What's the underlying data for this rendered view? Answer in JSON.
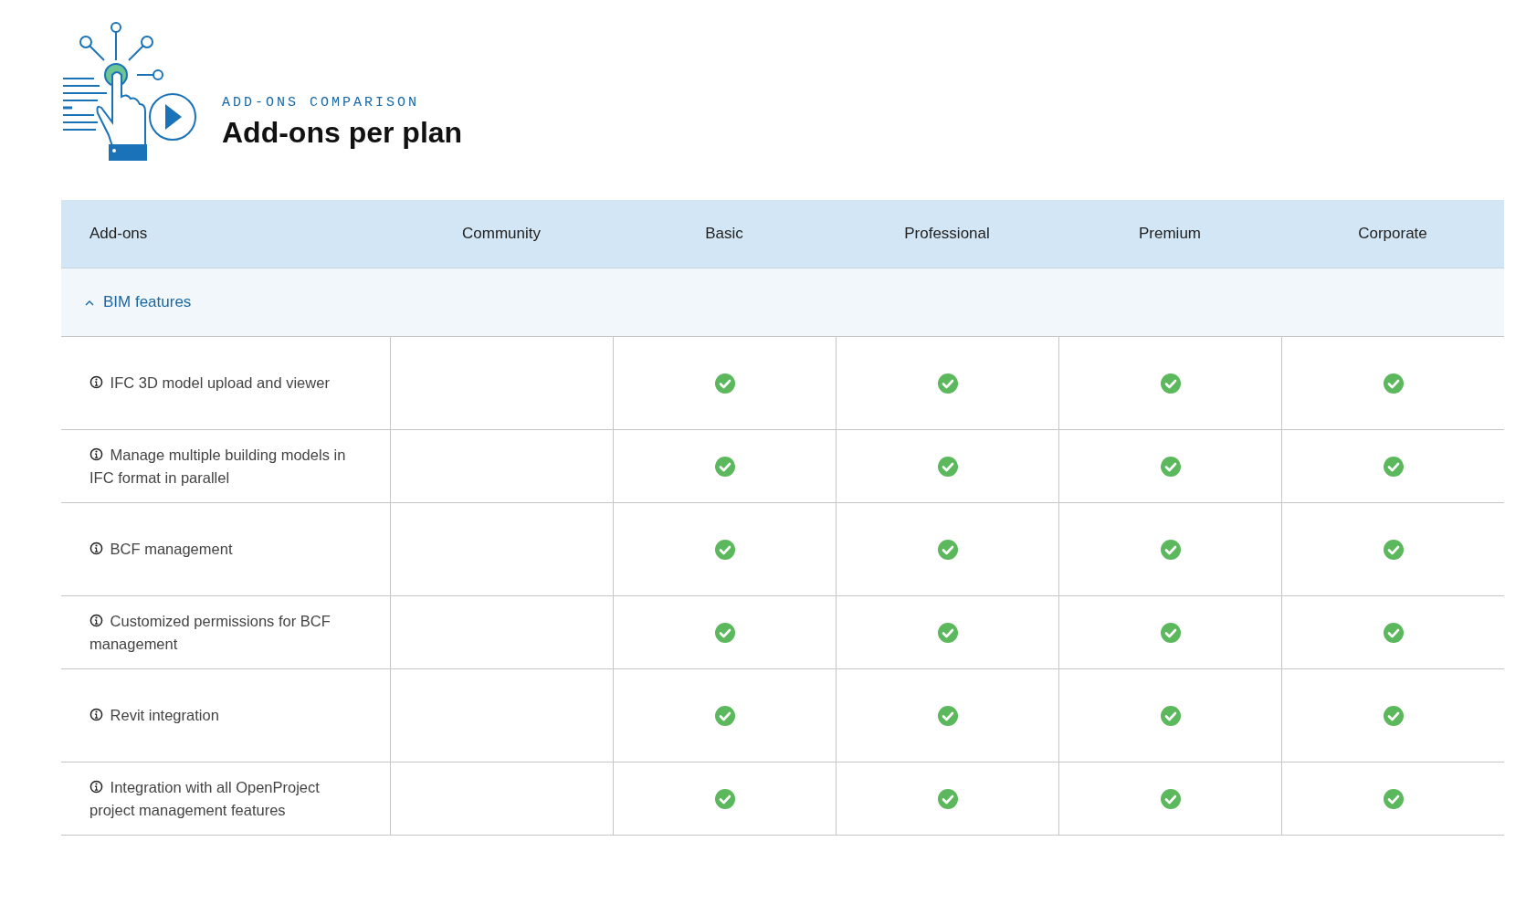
{
  "header": {
    "eyebrow": "ADD-ONS COMPARISON",
    "title": "Add-ons per plan"
  },
  "table": {
    "columns": [
      "Add-ons",
      "Community",
      "Basic",
      "Professional",
      "Premium",
      "Corporate"
    ],
    "groups": [
      {
        "label": "BIM features",
        "expanded": true,
        "rows": [
          {
            "feature": "IFC 3D model upload and viewer",
            "included": [
              false,
              true,
              true,
              true,
              true
            ]
          },
          {
            "feature": "Manage multiple building models in IFC format in parallel",
            "included": [
              false,
              true,
              true,
              true,
              true
            ]
          },
          {
            "feature": "BCF management",
            "included": [
              false,
              true,
              true,
              true,
              true
            ]
          },
          {
            "feature": "Customized permissions for BCF management",
            "included": [
              false,
              true,
              true,
              true,
              true
            ]
          },
          {
            "feature": "Revit integration",
            "included": [
              false,
              true,
              true,
              true,
              true
            ]
          },
          {
            "feature": "Integration with all OpenProject project management features",
            "included": [
              false,
              true,
              true,
              true,
              true
            ]
          }
        ]
      }
    ]
  }
}
